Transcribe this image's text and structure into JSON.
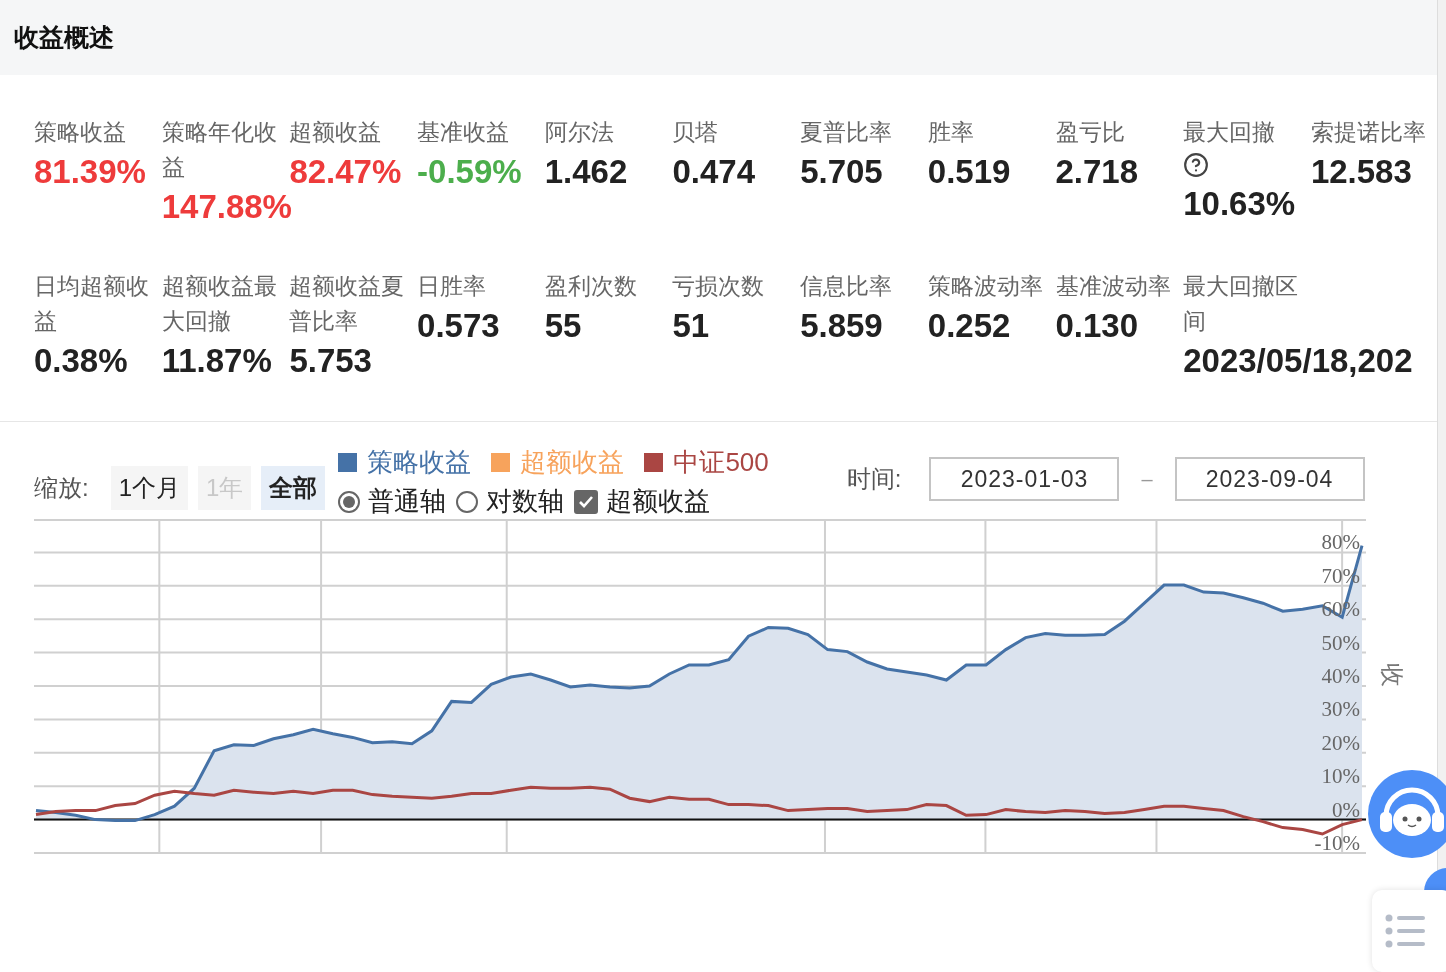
{
  "header": {
    "title": "收益概述"
  },
  "metrics": [
    {
      "label": "策略收益",
      "value": "81.39%",
      "color": "#ee3b3b"
    },
    {
      "label": "策略年化收益",
      "value": "147.88%",
      "color": "#ee3b3b"
    },
    {
      "label": "超额收益",
      "value": "82.47%",
      "color": "#ee3b3b"
    },
    {
      "label": "基准收益",
      "value": "-0.59%",
      "color": "#4cae4c"
    },
    {
      "label": "阿尔法",
      "value": "1.462",
      "color": "#222222"
    },
    {
      "label": "贝塔",
      "value": "0.474",
      "color": "#222222"
    },
    {
      "label": "夏普比率",
      "value": "5.705",
      "color": "#222222"
    },
    {
      "label": "胜率",
      "value": "0.519",
      "color": "#222222"
    },
    {
      "label": "盈亏比",
      "value": "2.718",
      "color": "#222222"
    },
    {
      "label": "最大回撤",
      "value": "10.63%",
      "color": "#222222",
      "help": true
    },
    {
      "label": "索提诺比率",
      "value": "12.583",
      "color": "#222222"
    },
    {
      "label": "日均超额收益",
      "value": "0.38%",
      "color": "#222222"
    },
    {
      "label": "超额收益最大回撤",
      "value": "11.87%",
      "color": "#222222"
    },
    {
      "label": "超额收益夏普比率",
      "value": "5.753",
      "color": "#222222"
    },
    {
      "label": "日胜率",
      "value": "0.573",
      "color": "#222222"
    },
    {
      "label": "盈利次数",
      "value": "55",
      "color": "#222222"
    },
    {
      "label": "亏损次数",
      "value": "51",
      "color": "#222222"
    },
    {
      "label": "信息比率",
      "value": "5.859",
      "color": "#222222"
    },
    {
      "label": "策略波动率",
      "value": "0.252",
      "color": "#222222"
    },
    {
      "label": "基准波动率",
      "value": "0.130",
      "color": "#222222"
    },
    {
      "label": "最大回撤区间",
      "value": "2023/05/18,202",
      "color": "#222222"
    }
  ],
  "zoom": {
    "label": "缩放:",
    "options": [
      {
        "label": "1个月",
        "selected": false,
        "disabled": false
      },
      {
        "label": "1年",
        "selected": false,
        "disabled": true
      },
      {
        "label": "全部",
        "selected": true,
        "disabled": false
      }
    ]
  },
  "axis_options": [
    {
      "kind": "radio",
      "label": "普通轴",
      "selected": true
    },
    {
      "kind": "radio",
      "label": "对数轴",
      "selected": false
    },
    {
      "kind": "checkbox",
      "label": "超额收益",
      "checked": true
    }
  ],
  "time_range": {
    "label": "时间:",
    "start": "2023-01-03",
    "separator": "–",
    "end": "2023-09-04"
  },
  "chart_data": {
    "type": "line",
    "ylabel": "收",
    "ylim": [
      -10,
      90
    ],
    "grid": true,
    "yticks": [
      {
        "value": -10,
        "label": "-10%"
      },
      {
        "value": 0,
        "label": "0%"
      },
      {
        "value": 10,
        "label": "10%"
      },
      {
        "value": 20,
        "label": "20%"
      },
      {
        "value": 30,
        "label": "30%"
      },
      {
        "value": 40,
        "label": "40%"
      },
      {
        "value": 50,
        "label": "50%"
      },
      {
        "value": 60,
        "label": "60%"
      },
      {
        "value": 70,
        "label": "70%"
      },
      {
        "value": 80,
        "label": "80%"
      }
    ],
    "series": [
      {
        "name": "策略收益",
        "color": "#4572a7",
        "values": [
          2.7,
          2.1,
          1.3,
          0,
          -0.3,
          -0.3,
          1.5,
          4,
          9.4,
          20.6,
          22.4,
          22.2,
          24.2,
          25.4,
          27,
          25.7,
          24.6,
          23,
          23.3,
          22.7,
          26.6,
          35.4,
          35.1,
          40.5,
          42.7,
          43.6,
          41.8,
          39.7,
          40.3,
          39.7,
          39.4,
          40,
          43.6,
          46.3,
          46.3,
          47.9,
          54.9,
          57.5,
          57.3,
          55.4,
          50.9,
          50.3,
          47.2,
          45.1,
          44.2,
          43.3,
          41.8,
          46.3,
          46.3,
          50.9,
          54.5,
          55.7,
          55.2,
          55.2,
          55.4,
          59.4,
          64.8,
          70.2,
          70.2,
          68.1,
          67.8,
          66.4,
          64.8,
          62.4,
          63,
          64,
          60.6,
          82
        ]
      },
      {
        "name": "超额收益",
        "color": "#f7a35c",
        "values": [
          null,
          null,
          null,
          null,
          null,
          null,
          null,
          null,
          null,
          null,
          null,
          null,
          null,
          null,
          null,
          null,
          null,
          null,
          null,
          null,
          null,
          null,
          null,
          null,
          null,
          null,
          null,
          null,
          null,
          null,
          null,
          null,
          null,
          null,
          null,
          null,
          null,
          null,
          null,
          null,
          null,
          null,
          null,
          null,
          null,
          null,
          null,
          null,
          null,
          null,
          null,
          null,
          null,
          null,
          null,
          null,
          null,
          null,
          null,
          null,
          null,
          null,
          null,
          null,
          null,
          null,
          null,
          null
        ]
      },
      {
        "name": "中证500",
        "color": "#aa4643",
        "values": [
          1.5,
          2.4,
          2.7,
          2.7,
          4.2,
          4.8,
          7.3,
          8.5,
          7.8,
          7.3,
          8.8,
          8.2,
          7.8,
          8.5,
          7.8,
          8.8,
          8.8,
          7.5,
          7,
          6.7,
          6.4,
          7,
          7.8,
          7.8,
          8.8,
          9.7,
          9.4,
          9.4,
          9.7,
          9.1,
          6.4,
          5.4,
          6.7,
          6.1,
          6.1,
          4.5,
          4.5,
          4.2,
          2.7,
          3,
          3.3,
          3.3,
          2.4,
          2.7,
          3,
          4.5,
          4.2,
          1.3,
          1.5,
          3,
          2.4,
          2.1,
          2.7,
          2.4,
          1.8,
          2.1,
          3,
          4,
          4,
          3.3,
          2.7,
          0.9,
          -0.6,
          -2.4,
          -3,
          -4.3,
          -1.5,
          0
        ]
      }
    ]
  }
}
